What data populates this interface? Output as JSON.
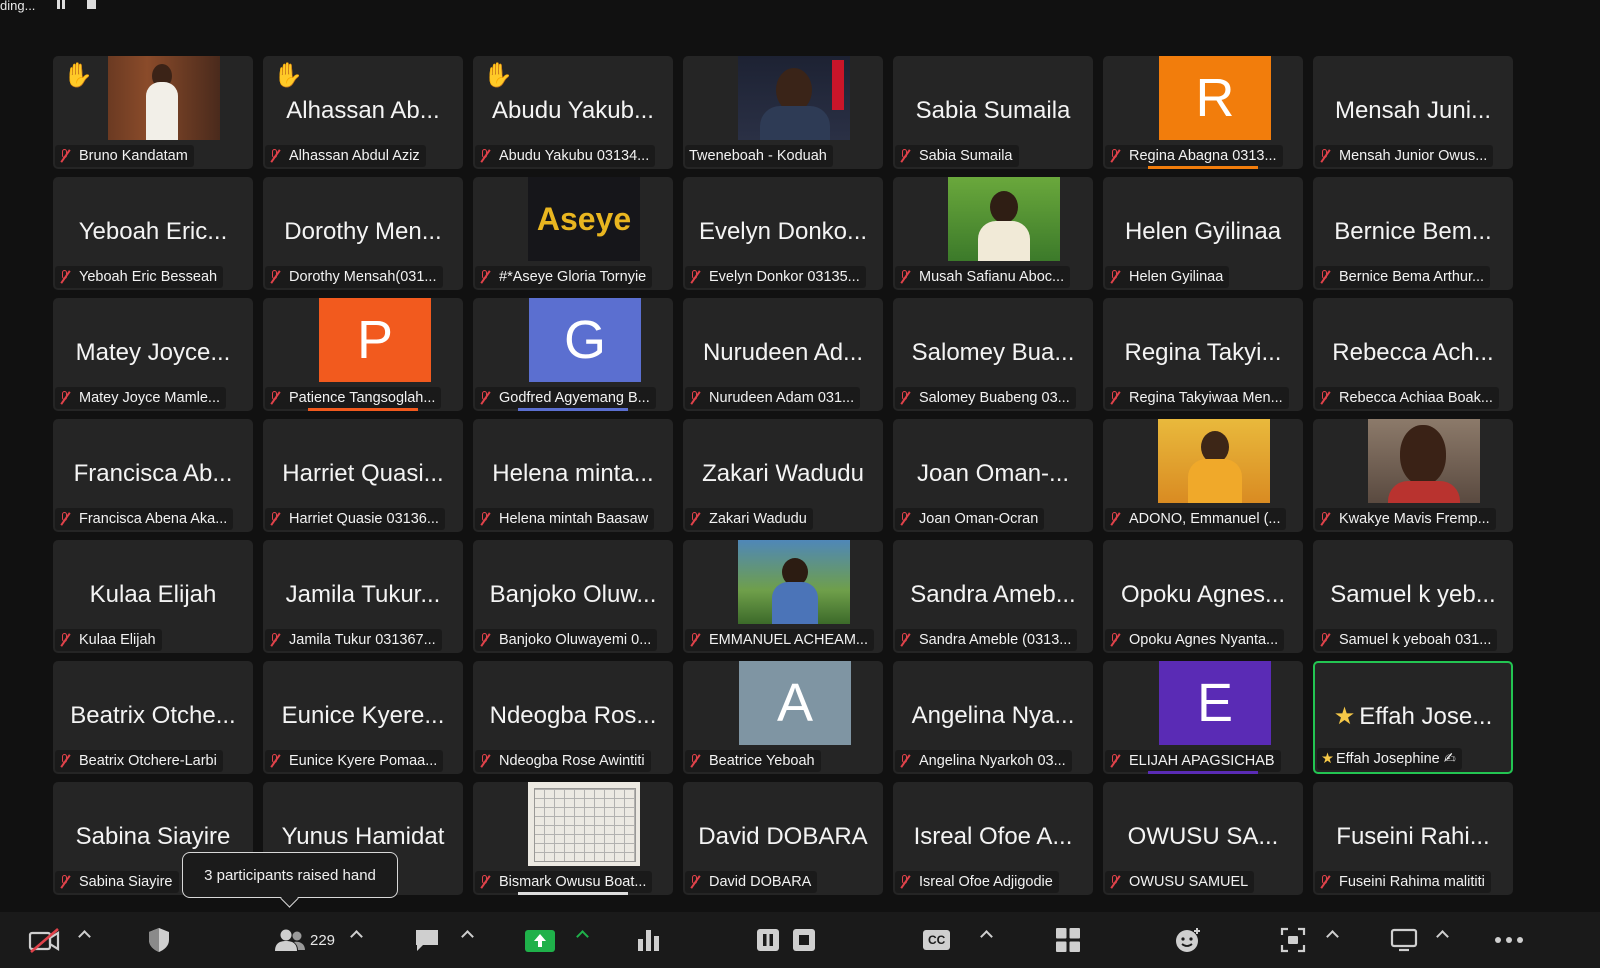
{
  "recording": {
    "status": "ding..."
  },
  "tiles": [
    {
      "big": "",
      "label": "Bruno Kandatam",
      "hand": true,
      "photo": "bruno"
    },
    {
      "big": "Alhassan Ab...",
      "label": "Alhassan Abdul Aziz",
      "hand": true
    },
    {
      "big": "Abudu Yakub...",
      "label": "Abudu Yakubu 03134...",
      "hand": true
    },
    {
      "big": "",
      "label": "Tweneboah - Koduah",
      "photo": "twene",
      "mic": false
    },
    {
      "big": "Sabia Sumaila",
      "label": "Sabia Sumaila"
    },
    {
      "big": "",
      "label": "Regina Abagna 0313...",
      "avatar": "R",
      "avatar_color": "#f27d0c",
      "underline": "#f27d0c"
    },
    {
      "big": "Mensah Juni...",
      "label": "Mensah Junior Owus..."
    },
    {
      "big": "Yeboah Eric...",
      "label": "Yeboah Eric Besseah"
    },
    {
      "big": "Dorothy Men...",
      "label": "Dorothy Mensah(031..."
    },
    {
      "big": "",
      "label": "#*Aseye Gloria Tornyie",
      "photo": "aseye",
      "photo_text": "Aseye"
    },
    {
      "big": "Evelyn Donko...",
      "label": "Evelyn Donkor 03135..."
    },
    {
      "big": "",
      "label": "Musah Safianu Aboc...",
      "photo": "musah"
    },
    {
      "big": "Helen Gyilinaa",
      "label": "Helen Gyilinaa"
    },
    {
      "big": "Bernice Bem...",
      "label": "Bernice Bema Arthur..."
    },
    {
      "big": "Matey Joyce...",
      "label": "Matey Joyce Mamle..."
    },
    {
      "big": "",
      "label": "Patience Tangsoglah...",
      "avatar": "P",
      "avatar_color": "#f25a1e",
      "underline": "#f25a1e"
    },
    {
      "big": "",
      "label": "Godfred Agyemang B...",
      "avatar": "G",
      "avatar_color": "#5b6fd0",
      "underline": "#5b6fd0"
    },
    {
      "big": "Nurudeen Ad...",
      "label": "Nurudeen Adam 031..."
    },
    {
      "big": "Salomey Bua...",
      "label": "Salomey Buabeng 03..."
    },
    {
      "big": "Regina Takyi...",
      "label": "Regina Takyiwaa Men..."
    },
    {
      "big": "Rebecca Ach...",
      "label": "Rebecca Achiaa Boak..."
    },
    {
      "big": "Francisca Ab...",
      "label": "Francisca Abena Aka..."
    },
    {
      "big": "Harriet Quasi...",
      "label": "Harriet Quasie 03136..."
    },
    {
      "big": "Helena minta...",
      "label": "Helena mintah Baasaw"
    },
    {
      "big": "Zakari Wadudu",
      "label": "Zakari Wadudu"
    },
    {
      "big": "Joan Oman-...",
      "label": "Joan Oman-Ocran"
    },
    {
      "big": "",
      "label": "ADONO, Emmanuel (...",
      "photo": "adono"
    },
    {
      "big": "",
      "label": "Kwakye Mavis Fremp...",
      "photo": "kwakye"
    },
    {
      "big": "Kulaa Elijah",
      "label": "Kulaa Elijah"
    },
    {
      "big": "Jamila Tukur...",
      "label": "Jamila Tukur 031367..."
    },
    {
      "big": "Banjoko Oluw...",
      "label": "Banjoko Oluwayemi 0..."
    },
    {
      "big": "",
      "label": "EMMANUEL ACHEAM...",
      "photo": "emma"
    },
    {
      "big": "Sandra Ameb...",
      "label": "Sandra Ameble (0313..."
    },
    {
      "big": "Opoku Agnes...",
      "label": "Opoku Agnes Nyanta..."
    },
    {
      "big": "Samuel k yeb...",
      "label": "Samuel k yeboah 031..."
    },
    {
      "big": "Beatrix Otche...",
      "label": "Beatrix Otchere-Larbi"
    },
    {
      "big": "Eunice Kyere...",
      "label": "Eunice Kyere  Pomaa..."
    },
    {
      "big": "Ndeogba Ros...",
      "label": "Ndeogba Rose Awintiti"
    },
    {
      "big": "",
      "label": "Beatrice Yeboah",
      "avatar": "A",
      "avatar_color": "#7f95a3"
    },
    {
      "big": "Angelina Nya...",
      "label": "Angelina Nyarkoh 03..."
    },
    {
      "big": "",
      "label": "ELIJAH APAGSICHAB",
      "avatar": "E",
      "avatar_color": "#5a2bb5",
      "underline": "#5a2bb5"
    },
    {
      "big": "Effah Jose...",
      "label": "Effah Josephine ✍",
      "active": true,
      "star": true,
      "mic": false
    },
    {
      "big": "Sabina Siayire",
      "label": "Sabina Siayire"
    },
    {
      "big": "Yunus Hamidat",
      "label": "",
      "mic": false
    },
    {
      "big": "",
      "label": "Bismark Owusu Boat...",
      "photo": "bismark",
      "underline": "#dddddd"
    },
    {
      "big": "David DOBARA",
      "label": "David DOBARA"
    },
    {
      "big": "Isreal Ofoe A...",
      "label": "Isreal Ofoe Adjigodie"
    },
    {
      "big": "OWUSU SA...",
      "label": "OWUSU SAMUEL"
    },
    {
      "big": "Fuseini Rahi...",
      "label": "Fuseini Rahima malititi"
    }
  ],
  "tooltip": {
    "text": "3 participants raised hand"
  },
  "toolbar": {
    "participants_count": "229",
    "cc_label": "CC"
  },
  "colors": {
    "active_border": "#23c552",
    "muted_mic": "#e0424a",
    "share_green": "#1fb14a"
  }
}
